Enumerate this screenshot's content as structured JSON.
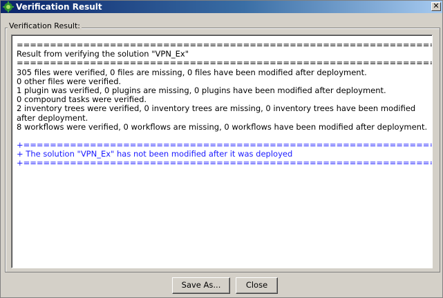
{
  "window": {
    "title": "Verification Result",
    "close_glyph": "✕"
  },
  "group": {
    "label": "Verification Result:"
  },
  "result_text": {
    "separator_top": "==================================================================",
    "heading": "Result from verifying the solution \"VPN_Ex\"",
    "separator_mid": "==================================================================",
    "lines": [
      "305 files were verified, 0 files are missing, 0 files have been modified after deployment.",
      "0 other files were verified.",
      "1 plugin was verified, 0 plugins are missing, 0 plugins have been modified after deployment.",
      "0 compound tasks were verified.",
      "2 inventory trees were verified, 0 inventory trees are missing, 0 inventory trees have been modified after deployment.",
      "8 workflows were verified, 0 workflows are missing, 0 workflows have been modified after deployment."
    ],
    "summary_separator_top": "+=================================================================",
    "summary": "+ The solution \"VPN_Ex\" has not been modified after it was deployed",
    "summary_separator_bottom": "+=================================================================",
    "summary_color": "#1a1aff"
  },
  "buttons": {
    "save_as": "Save As...",
    "close": "Close"
  },
  "icons": {
    "title_icon": "orchestrator-icon"
  }
}
